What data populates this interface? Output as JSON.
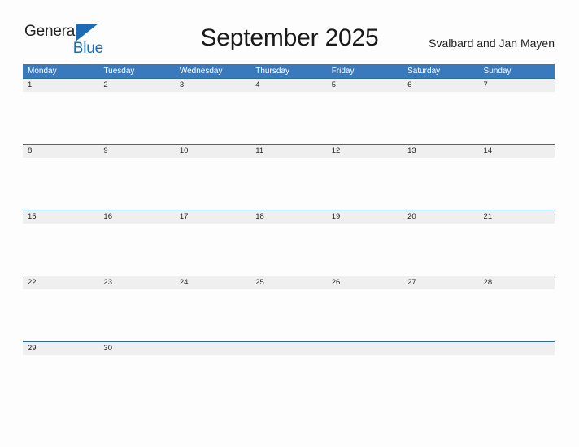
{
  "brand": {
    "name_top": "General",
    "name_bottom": "Blue",
    "flag_icon": "blue-triangle-flag",
    "accent_color": "#1b6cb4"
  },
  "header": {
    "title": "September 2025",
    "region": "Svalbard and Jan Mayen"
  },
  "theme": {
    "header_blue": "#3b79bd",
    "row_rule_blue": "#2e6da8",
    "date_band_gray": "#efefef",
    "page_background": "#fdfdfd",
    "text_dark": "#262626"
  },
  "calendar": {
    "month": "September",
    "year": "2025",
    "weekday_headers": [
      "Monday",
      "Tuesday",
      "Wednesday",
      "Thursday",
      "Friday",
      "Saturday",
      "Sunday"
    ],
    "weeks": [
      {
        "days": [
          "1",
          "2",
          "3",
          "4",
          "5",
          "6",
          "7"
        ]
      },
      {
        "days": [
          "8",
          "9",
          "10",
          "11",
          "12",
          "13",
          "14"
        ]
      },
      {
        "days": [
          "15",
          "16",
          "17",
          "18",
          "19",
          "20",
          "21"
        ]
      },
      {
        "days": [
          "22",
          "23",
          "24",
          "25",
          "26",
          "27",
          "28"
        ]
      },
      {
        "days": [
          "29",
          "30",
          "",
          "",
          "",
          "",
          ""
        ]
      }
    ]
  }
}
